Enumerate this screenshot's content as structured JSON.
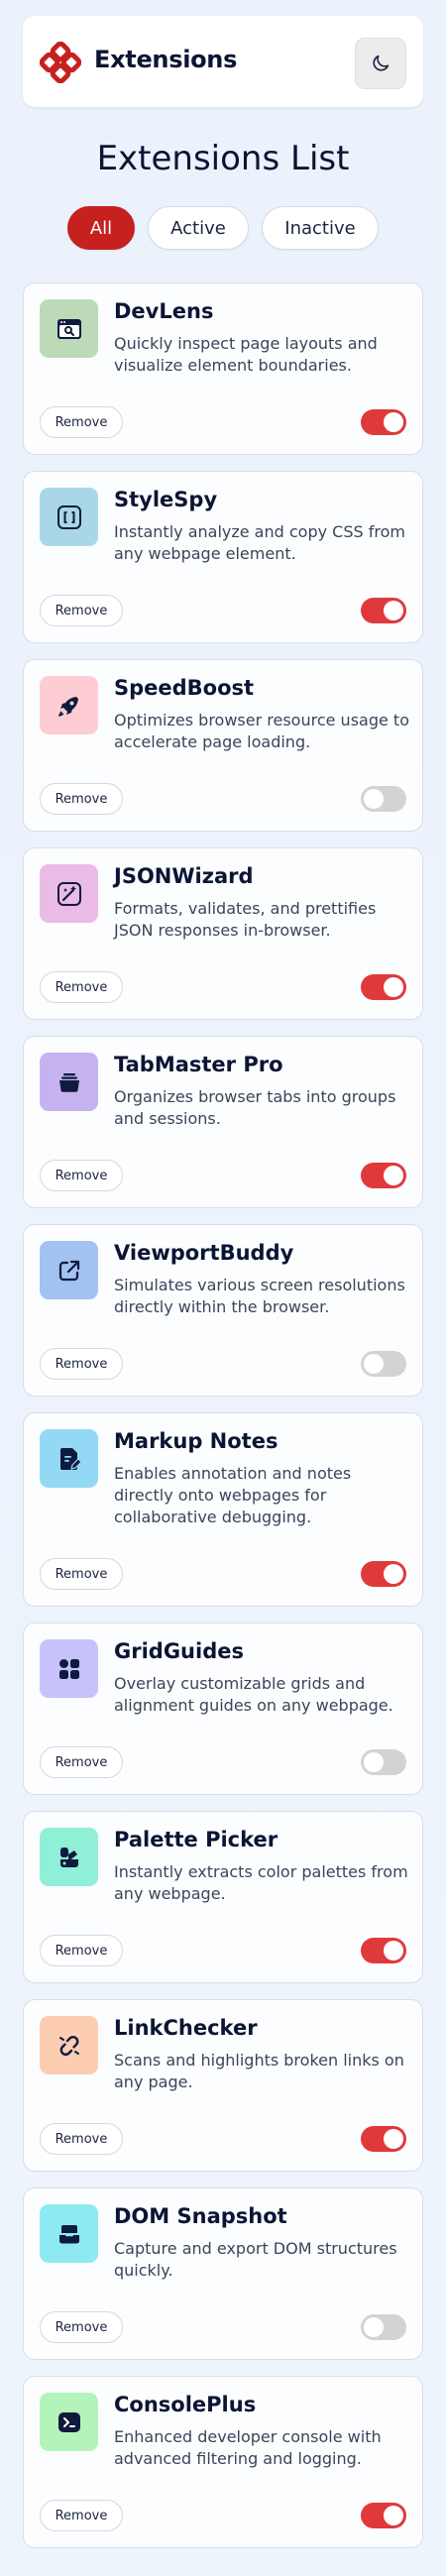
{
  "header": {
    "app_title": "Extensions",
    "logo_icon": "logo-icon",
    "theme_toggle_icon": "moon-icon"
  },
  "page_title": "Extensions List",
  "filters": [
    {
      "label": "All",
      "selected": true
    },
    {
      "label": "Active",
      "selected": false
    },
    {
      "label": "Inactive",
      "selected": false
    }
  ],
  "colors": {
    "accent": "#c7211f",
    "toggle_on": "#e0393c",
    "toggle_off": "#d3d3d3"
  },
  "remove_label": "Remove",
  "extensions": [
    {
      "name": "DevLens",
      "description": "Quickly inspect page layouts and visualize element boundaries.",
      "active": true,
      "icon": "inspect-window-icon",
      "icon_bg": "#bcdab8"
    },
    {
      "name": "StyleSpy",
      "description": "Instantly analyze and copy CSS from any webpage element.",
      "active": true,
      "icon": "code-brackets-icon",
      "icon_bg": "#a9d7e8"
    },
    {
      "name": "SpeedBoost",
      "description": "Optimizes browser resource usage to accelerate page loading.",
      "active": false,
      "icon": "rocket-icon",
      "icon_bg": "#fdcdd3"
    },
    {
      "name": "JSONWizard",
      "description": "Formats, validates, and prettifies JSON responses in-browser.",
      "active": true,
      "icon": "wand-icon",
      "icon_bg": "#eabbe6"
    },
    {
      "name": "TabMaster Pro",
      "description": "Organizes browser tabs into groups and sessions.",
      "active": true,
      "icon": "tabs-stack-icon",
      "icon_bg": "#c5b3ef"
    },
    {
      "name": "ViewportBuddy",
      "description": "Simulates various screen resolutions directly within the browser.",
      "active": false,
      "icon": "external-link-icon",
      "icon_bg": "#a2c2f1"
    },
    {
      "name": "Markup Notes",
      "description": "Enables annotation and notes directly onto webpages for collaborative debugging.",
      "active": true,
      "icon": "note-edit-icon",
      "icon_bg": "#93d9f5"
    },
    {
      "name": "GridGuides",
      "description": "Overlay customizable grids and alignment guides on any webpage.",
      "active": false,
      "icon": "grid-icon",
      "icon_bg": "#c7c2fb"
    },
    {
      "name": "Palette Picker",
      "description": "Instantly extracts color palettes from any webpage.",
      "active": true,
      "icon": "palette-icon",
      "icon_bg": "#90efd7"
    },
    {
      "name": "LinkChecker",
      "description": "Scans and highlights broken links on any page.",
      "active": true,
      "icon": "broken-link-icon",
      "icon_bg": "#fccdb1"
    },
    {
      "name": "DOM Snapshot",
      "description": "Capture and export DOM structures quickly.",
      "active": false,
      "icon": "snapshot-icon",
      "icon_bg": "#8eeaf2"
    },
    {
      "name": "ConsolePlus",
      "description": "Enhanced developer console with advanced filtering and logging.",
      "active": true,
      "icon": "terminal-icon",
      "icon_bg": "#b4f4ba"
    }
  ]
}
